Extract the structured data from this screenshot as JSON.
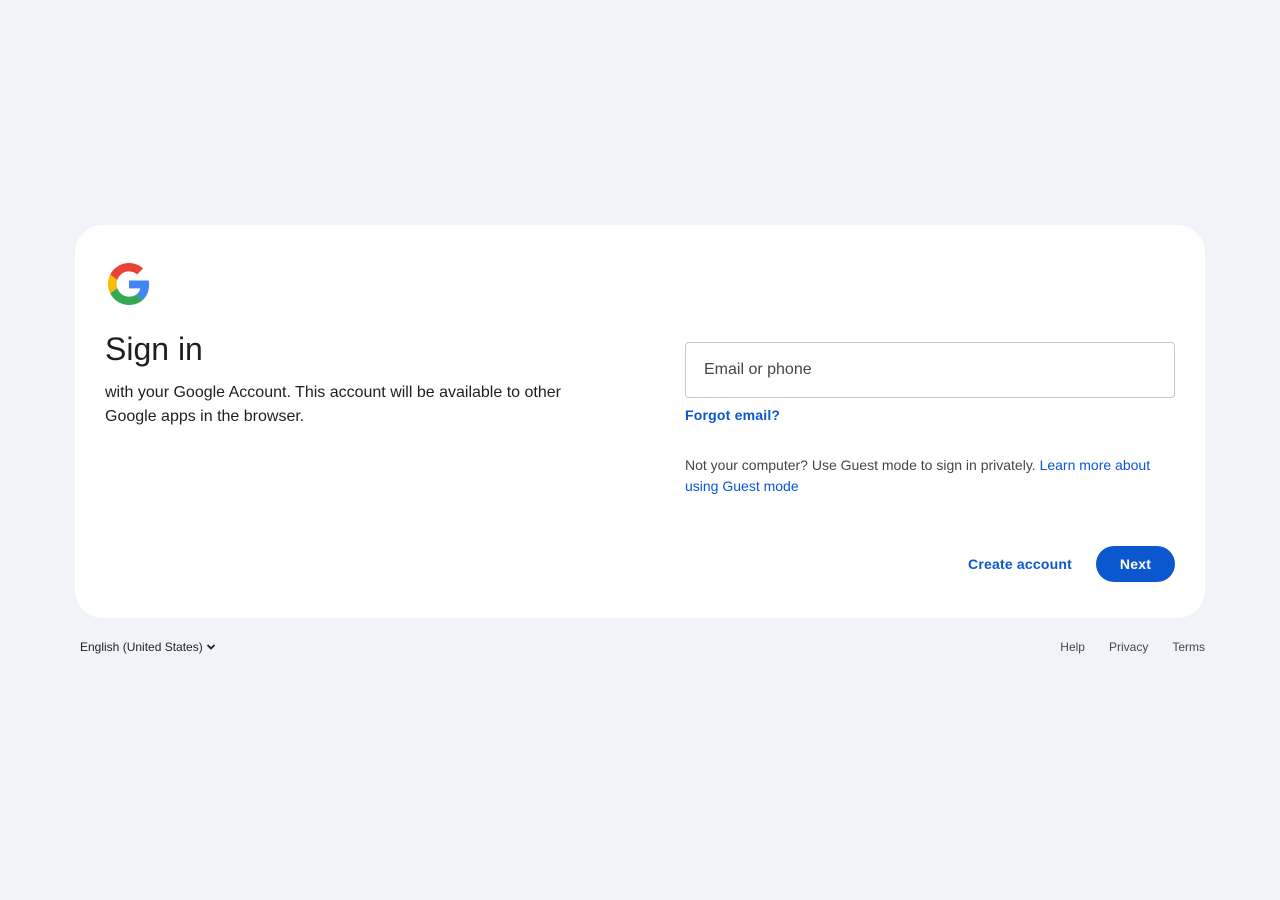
{
  "app": {
    "brand_colors": {
      "blue": "#4285F4",
      "red": "#EA4335",
      "yellow": "#FBBC05",
      "green": "#34A853",
      "accent": "#0b57d0"
    },
    "logo_icon": "google-g-logo"
  },
  "signin": {
    "title": "Sign in",
    "subtitle": "with your Google Account. This account will be available to other Google apps in the browser.",
    "email_placeholder": "Email or phone",
    "email_value": "",
    "forgot_email": "Forgot email?",
    "guest_text": "Not your computer? Use Guest mode to sign in privately. ",
    "guest_link": "Learn more about using Guest mode",
    "create_account": "Create account",
    "next": "Next"
  },
  "footer": {
    "language": "English (United States)",
    "language_icon": "chevron-down-icon",
    "links": {
      "help": "Help",
      "privacy": "Privacy",
      "terms": "Terms"
    }
  }
}
